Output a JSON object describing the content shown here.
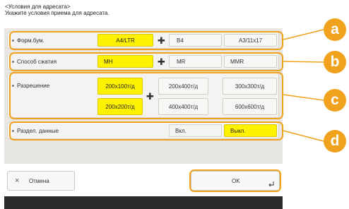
{
  "header": {
    "title": "<Условия для адресата>",
    "subtitle": "Укажите условия приема для адресата."
  },
  "sections": {
    "paper_size": {
      "label": "Форм.бум.",
      "options": [
        "A4/LTR",
        "B4",
        "A3/11x17"
      ]
    },
    "compression": {
      "label": "Способ сжатия",
      "options": [
        "MH",
        "MR",
        "MMR"
      ]
    },
    "resolution": {
      "label": "Разрешение",
      "options": [
        "200x100т/д",
        "200x400т/д",
        "300x300т/д",
        "200x200т/д",
        "400x400т/д",
        "600x600т/д"
      ]
    },
    "split_data": {
      "label": "Раздел. данные",
      "options": [
        "Вкл.",
        "Выкл."
      ]
    }
  },
  "footer": {
    "cancel_label": "Отмена",
    "cancel_icon": "×",
    "ok_label": "OK"
  },
  "callouts": [
    "a",
    "b",
    "c",
    "d"
  ],
  "colors": {
    "selected": "#fff200",
    "callout": "#f0a21c"
  }
}
